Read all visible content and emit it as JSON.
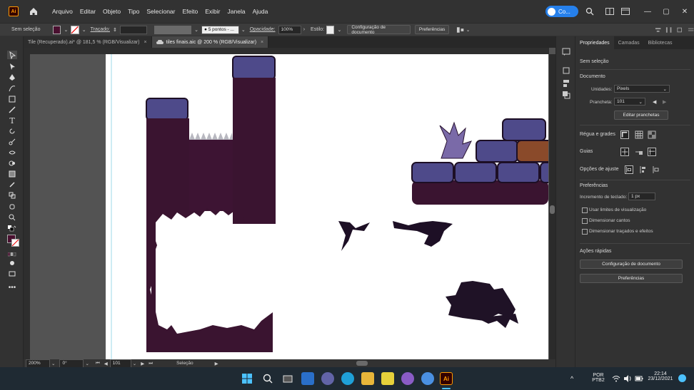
{
  "app": {
    "logo": "Ai",
    "menu": [
      "Arquivo",
      "Editar",
      "Objeto",
      "Tipo",
      "Selecionar",
      "Efeito",
      "Exibir",
      "Janela",
      "Ajuda"
    ],
    "user_label": "Co..."
  },
  "control_bar": {
    "selection": "Sem seleção",
    "stroke_label": "Traçado:",
    "brush": "5 pontos - ...",
    "opacity_label": "Opacidade:",
    "opacity_value": "100%",
    "style_label": "Estilo:",
    "doc_setup_button": "Configuração de documento",
    "preferences_button": "Preferências"
  },
  "tabs": [
    {
      "label": "Tile (Recuperado).ai* @ 181,5 % (RGB/Visualizar)",
      "close": "×"
    },
    {
      "label": "tiles finais.aic @ 200 % (RGB/Visualizar)",
      "close": "×"
    }
  ],
  "status_bar": {
    "zoom": "200%",
    "rotation": "0°",
    "artboard_number": "101",
    "tool_status": "Seleção"
  },
  "panel": {
    "tabs": [
      "Propriedades",
      "Camadas",
      "Bibliotecas"
    ],
    "no_selection": "Sem seleção",
    "document_section": "Documento",
    "units_label": "Unidades:",
    "units_value": "Pixels",
    "artboard_label": "Prancheta:",
    "artboard_value": "101",
    "edit_artboards_button": "Editar pranchetas",
    "rulers_grids": "Régua e grades",
    "guides": "Guias",
    "snap_options": "Opções de ajuste",
    "preferences_section": "Preferências",
    "keyboard_increment_label": "Incremento de teclado:",
    "keyboard_increment_value": "1 px",
    "checkboxes": [
      "Usar limites de visualização",
      "Dimensionar cantos",
      "Dimensionar traçados e efeitos"
    ],
    "quick_actions": "Ações rápidas",
    "doc_setup_button": "Configuração de documento",
    "preferences_button": "Preferências"
  },
  "taskbar": {
    "language": "POR",
    "layout": "PTB2",
    "time": "22:14",
    "date": "23/12/2021"
  },
  "colors": {
    "fill_swatch": "#4a1030",
    "tile_dark": "#3a1430",
    "stone": "#4e4a8a",
    "brick": "#8a4a2a",
    "accent": "#2680eb"
  }
}
